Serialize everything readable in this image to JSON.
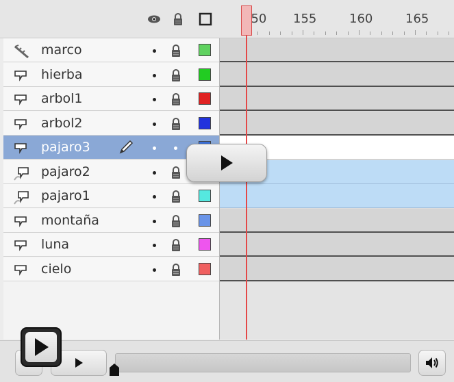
{
  "timeline": {
    "header_icons": [
      "eye-icon",
      "lock-icon",
      "outline-icon"
    ],
    "ruler_labels": [
      "150",
      "155",
      "160",
      "165"
    ],
    "layers": [
      {
        "name": "marco",
        "icon": "guide-icon",
        "color": "#5fd25f",
        "selected": false
      },
      {
        "name": "hierba",
        "icon": "layer-icon",
        "color": "#22cc22",
        "selected": false
      },
      {
        "name": "arbol1",
        "icon": "layer-icon",
        "color": "#e02222",
        "selected": false
      },
      {
        "name": "arbol2",
        "icon": "layer-icon",
        "color": "#2233dd",
        "selected": false
      },
      {
        "name": "pajaro3",
        "icon": "layer-icon",
        "color": "#3a6fd8",
        "selected": true
      },
      {
        "name": "pajaro2",
        "icon": "motion-guided-icon",
        "color": "#66bb44",
        "selected": false
      },
      {
        "name": "pajaro1",
        "icon": "motion-guided-icon",
        "color": "#55e8e0",
        "selected": false
      },
      {
        "name": "montaña",
        "icon": "layer-icon",
        "color": "#6a94e8",
        "selected": false
      },
      {
        "name": "luna",
        "icon": "layer-icon",
        "color": "#ee55ee",
        "selected": false
      },
      {
        "name": "cielo",
        "icon": "layer-icon",
        "color": "#f06060",
        "selected": false
      }
    ],
    "frame_rows": [
      "keyframe",
      "keyframe",
      "keyframe",
      "keyframe",
      "selected",
      "tween",
      "tween",
      "keyframe",
      "keyframe",
      "keyframe"
    ]
  },
  "player": {
    "overlay_play_icon": "play-icon",
    "big_play_icon": "play-icon",
    "volume_icon": "speaker-icon"
  }
}
